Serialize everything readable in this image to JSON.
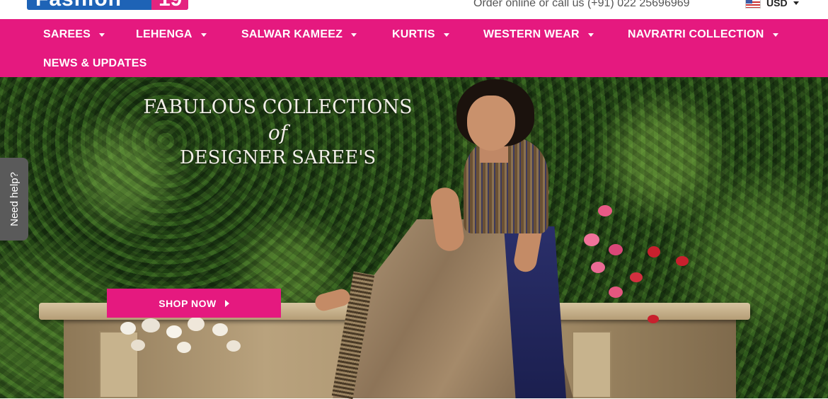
{
  "brand": {
    "logo_text": "Fashion",
    "logo_accent": "19",
    "primary_color": "#1e63b6",
    "accent_color": "#e5197f"
  },
  "topbar": {
    "order_text": "Order online or call us (+91) 022 25696969",
    "currency": "USD",
    "flag_icon": "us-flag-icon"
  },
  "nav": {
    "items": [
      {
        "label": "SAREES",
        "has_dropdown": true
      },
      {
        "label": "LEHENGA",
        "has_dropdown": true
      },
      {
        "label": "SALWAR KAMEEZ",
        "has_dropdown": true
      },
      {
        "label": "KURTIS",
        "has_dropdown": true
      },
      {
        "label": "WESTERN WEAR",
        "has_dropdown": true
      },
      {
        "label": "NAVRATRI COLLECTION",
        "has_dropdown": true
      },
      {
        "label": "NEWS & UPDATES",
        "has_dropdown": false
      }
    ]
  },
  "hero": {
    "line1": "FABULOUS COLLECTIONS",
    "line2": "of",
    "line3": "DESIGNER SAREE'S",
    "cta_label": "SHOP NOW"
  },
  "help": {
    "label": "Need help?"
  }
}
